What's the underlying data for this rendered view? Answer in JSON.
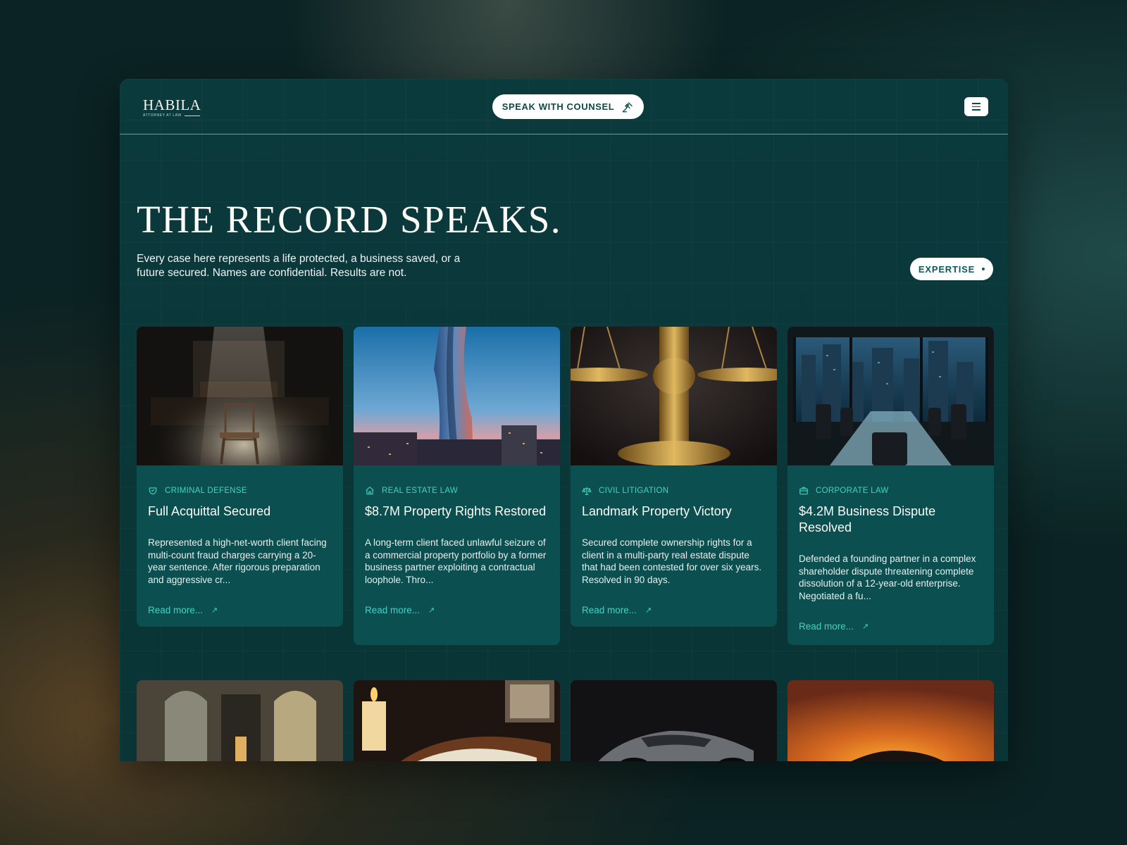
{
  "brand": {
    "name": "HABILA",
    "tagline": "ATTORNEY AT LAW"
  },
  "header": {
    "cta_label": "SPEAK WITH COUNSEL",
    "menu_icon": "hamburger-icon"
  },
  "hero": {
    "title": "THE RECORD SPEAKS.",
    "subtitle": "Every case here represents a life protected, a business saved, or a future secured. Names are confidential. Results are not.",
    "expertise_label": "EXPERTISE"
  },
  "cards": [
    {
      "category": "CRIMINAL DEFENSE",
      "icon": "shield-icon",
      "title": "Full Acquittal Secured",
      "description": "Represented a high-net-worth client facing multi-count fraud charges carrying a 20-year sentence. After rigorous preparation and aggressive cr...",
      "link": "Read more...",
      "image": "empty chair in dark courtroom spotlight"
    },
    {
      "category": "REAL ESTATE LAW",
      "icon": "home-icon",
      "title": "$8.7M Property Rights Restored",
      "description": "A long-term client faced unlawful seizure of a commercial property portfolio by a former business partner exploiting a contractual loophole. Thro...",
      "link": "Read more...",
      "image": "twisted skyscraper at dusk"
    },
    {
      "category": "CIVIL LITIGATION",
      "icon": "scales-icon",
      "title": "Landmark Property Victory",
      "description": "Secured complete ownership rights for a client in a multi-party real estate dispute that had been contested for over six years. Resolved in 90 days.",
      "link": "Read more...",
      "image": "golden scales of justice"
    },
    {
      "category": "CORPORATE LAW",
      "icon": "briefcase-icon",
      "title": "$4.2M Business Dispute Resolved",
      "description": "Defended a founding partner in a complex shareholder dispute threatening complete dissolution of a 12-year-old enterprise. Negotiated a fu...",
      "link": "Read more...",
      "image": "boardroom overlooking city at night"
    }
  ],
  "thumbnails": [
    "grand hall with arched windows",
    "candle and old book",
    "silver sports car",
    "car silhouette at sunset"
  ]
}
